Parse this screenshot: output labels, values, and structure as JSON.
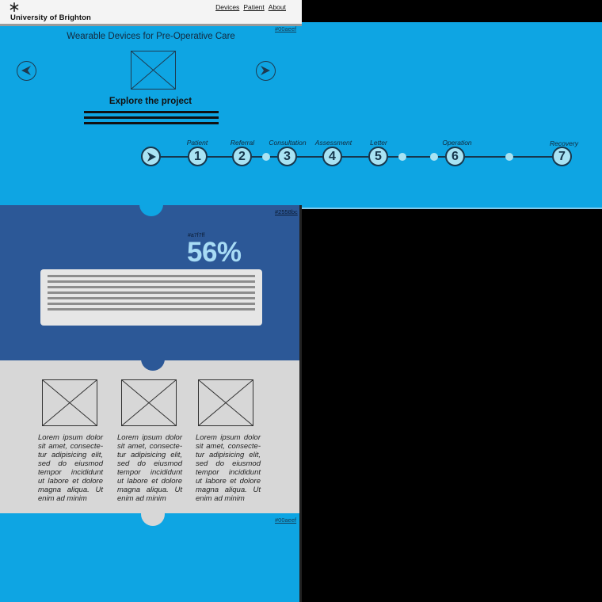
{
  "header": {
    "brand": "University of Brighton",
    "nav": [
      "Devices",
      "Patient",
      "About"
    ]
  },
  "hero": {
    "hex_label": "#00aeef",
    "title": "Wearable Devices for Pre-Operative Care",
    "explore_label": "Explore the project",
    "bg_color": "#0ea5e3"
  },
  "timeline": {
    "steps": [
      {
        "num": "",
        "label": "",
        "kind": "play"
      },
      {
        "num": "1",
        "label": "Patient"
      },
      {
        "num": "2",
        "label": "Referral"
      },
      {
        "num": "3",
        "label": "Consultation"
      },
      {
        "num": "4",
        "label": "Assessment"
      },
      {
        "num": "5",
        "label": "Letter"
      },
      {
        "num": "6",
        "label": "Operation"
      },
      {
        "num": "7",
        "label": "Recovery"
      }
    ]
  },
  "stats": {
    "hex_label": "#2558bc",
    "pct_hex": "#a7f7ff",
    "percentage": "56%",
    "bg_color": "#2c5897"
  },
  "features": {
    "items": [
      {
        "text": "Lorem ipsum dolor sit amet, consecte-tur adipisicing elit, sed do eiusmod tempor incididunt ut labore et dolore magna aliqua. Ut enim ad minim"
      },
      {
        "text": "Lorem ipsum dolor sit amet, consecte-tur adipisicing elit, sed do eiusmod tempor incididunt ut labore et dolore magna aliqua. Ut enim ad minim"
      },
      {
        "text": "Lorem ipsum dolor sit amet, consecte-tur adipisicing elit, sed do eiusmod tempor incididunt ut labore et dolore magna aliqua. Ut enim ad minim"
      }
    ]
  },
  "footer": {
    "hex_label": "#00aeef"
  }
}
